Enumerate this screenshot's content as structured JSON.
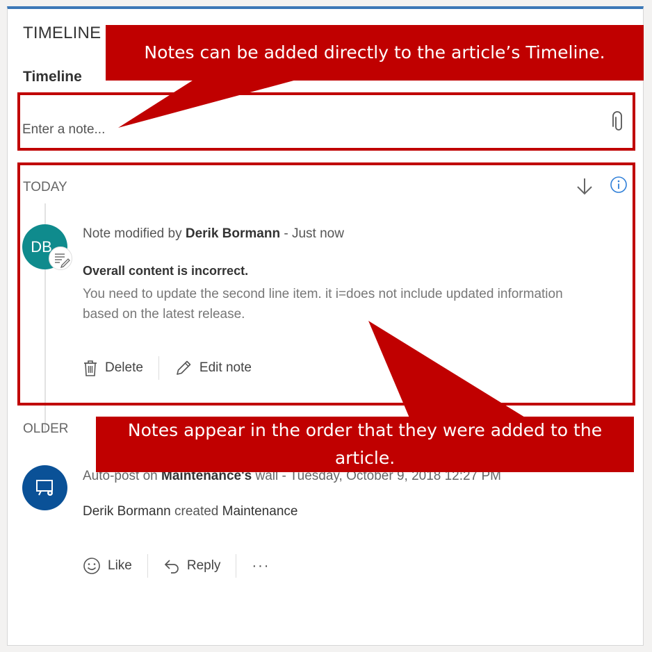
{
  "section_title": "TIMELINE",
  "timeline_label": "Timeline",
  "note_input": {
    "placeholder": "Enter a note..."
  },
  "today_group": {
    "label": "TODAY",
    "note": {
      "avatar_initials": "DB",
      "meta_prefix": "Note modified by",
      "author": "Derik Bormann",
      "separator": "-",
      "time": "Just now",
      "subject": "Overall content is incorrect.",
      "body": "You need to update the second line item.  it i=does not include updated information based on the latest release.",
      "actions": {
        "delete": "Delete",
        "edit": "Edit note"
      }
    }
  },
  "older_group": {
    "label": "OLDER",
    "post": {
      "meta_prefix": "Auto-post on",
      "wall_owner": "Maintenance's",
      "wall_suffix": "wall",
      "separator": "-",
      "time": "Tuesday, October 9, 2018 12:27 PM",
      "body_author": "Derik Bormann",
      "body_verb": "created",
      "body_object": "Maintenance",
      "actions": {
        "like": "Like",
        "reply": "Reply",
        "more": "···"
      }
    }
  },
  "callouts": {
    "top": "Notes can be added directly to the article’s Timeline.",
    "bottom": "Notes appear in the order that they were added to the article."
  },
  "colors": {
    "accent": "#3c78b7",
    "callout": "#c00000",
    "avatar_note": "#0f8b8d",
    "avatar_post": "#0a5197",
    "info_icon": "#2f7fd8"
  },
  "icons": [
    "paperclip-icon",
    "sort-down-icon",
    "info-icon",
    "note-edit-icon",
    "trash-icon",
    "pencil-icon",
    "system-post-icon",
    "smile-icon",
    "reply-icon",
    "more-icon"
  ]
}
